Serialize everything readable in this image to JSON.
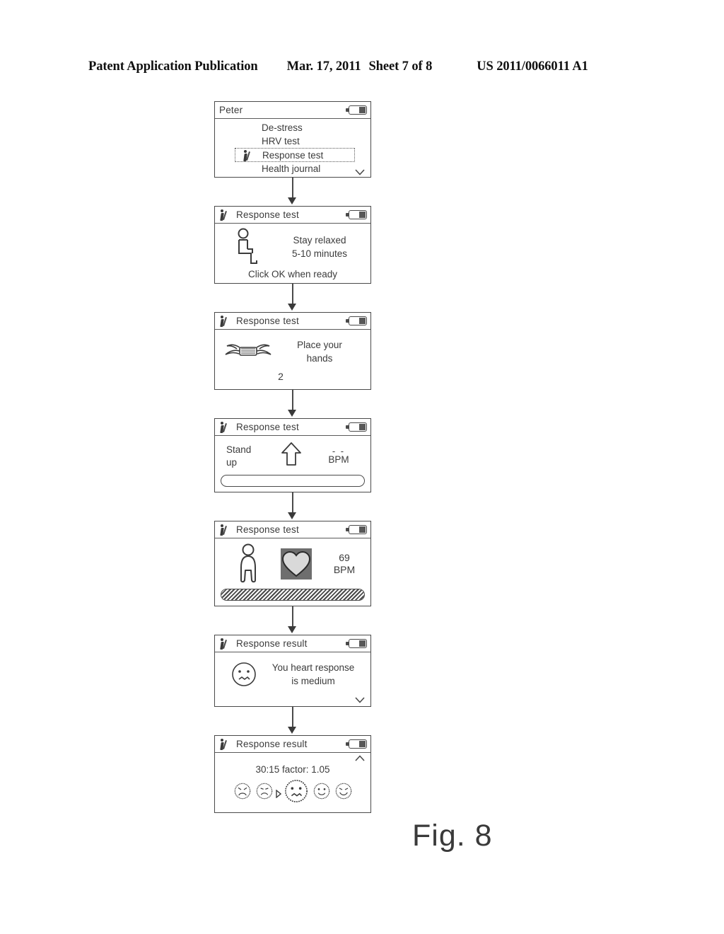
{
  "header": {
    "publication": "Patent Application Publication",
    "date": "Mar. 17, 2011",
    "sheet": "Sheet 7 of 8",
    "patent_number": "US 2011/0066011 A1"
  },
  "figure_label": "Fig. 8",
  "screens": [
    {
      "id": "menu",
      "title": "Peter",
      "title_icon": "none",
      "battery_icon": "battery-icon",
      "menu_items": [
        {
          "label": "De-stress",
          "selected": false
        },
        {
          "label": "HRV test",
          "selected": false
        },
        {
          "label": "Response test",
          "selected": true,
          "icon": "response-test-icon"
        },
        {
          "label": "Health journal",
          "selected": false
        }
      ],
      "scroll_indicator": "chevron-down-icon"
    },
    {
      "id": "stay-relaxed",
      "title": "Response test",
      "title_icon": "response-test-icon",
      "battery_icon": "battery-icon",
      "body_icon": "sitting-person-icon",
      "line1": "Stay relaxed",
      "line2": "5-10 minutes",
      "footer": "Click OK when ready"
    },
    {
      "id": "place-hands",
      "title": "Response test",
      "title_icon": "response-test-icon",
      "battery_icon": "battery-icon",
      "body_icon": "hands-on-sensor-icon",
      "line1": "Place your",
      "line2": "hands",
      "countdown": "2"
    },
    {
      "id": "stand-up",
      "title": "Response test",
      "title_icon": "response-test-icon",
      "battery_icon": "battery-icon",
      "line1": "Stand",
      "line2": "up",
      "arrow_icon": "arrow-up-icon",
      "bpm_dashes": "- -",
      "bpm_unit": "BPM",
      "progress_percent": 0
    },
    {
      "id": "measuring",
      "title": "Response test",
      "title_icon": "response-test-icon",
      "battery_icon": "battery-icon",
      "person_icon": "standing-person-icon",
      "heart_icon": "heart-icon",
      "bpm_value": "69",
      "bpm_unit": "BPM",
      "progress_percent": 100
    },
    {
      "id": "result-message",
      "title": "Response result",
      "title_icon": "response-test-icon",
      "battery_icon": "battery-icon",
      "face_icon": "neutral-face-icon",
      "line1": "You heart response",
      "line2": "is medium",
      "scroll_indicator": "chevron-down-icon"
    },
    {
      "id": "result-scale",
      "title": "Response result",
      "title_icon": "response-test-icon",
      "battery_icon": "battery-icon",
      "scroll_indicator": "chevron-up-icon",
      "factor_line": "30:15 factor: 1.05",
      "scale_faces": [
        {
          "mood": "very-sad-face-icon",
          "selected": false
        },
        {
          "mood": "sad-face-icon",
          "selected": false
        },
        {
          "mood": "neutral-face-icon",
          "selected": true
        },
        {
          "mood": "happy-face-icon",
          "selected": false
        },
        {
          "mood": "very-happy-face-icon",
          "selected": false
        }
      ],
      "selection_marker": "selection-pointer-icon"
    }
  ],
  "colors": {
    "ink": "#3b3b3b",
    "outline": "#4a4a4a",
    "background": "#ffffff"
  }
}
